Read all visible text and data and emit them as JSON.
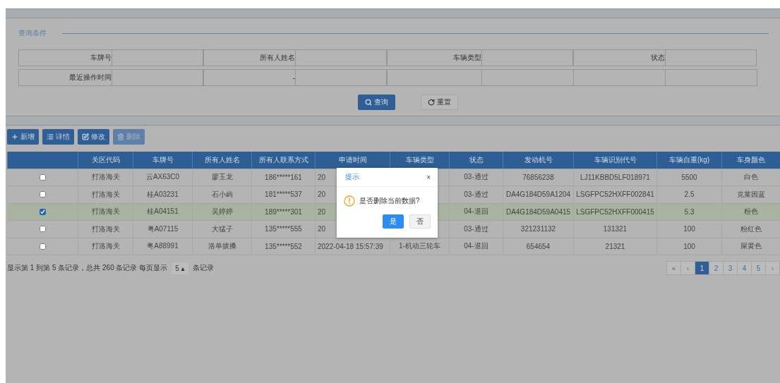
{
  "query_panel": {
    "title": "查询条件",
    "fields": [
      {
        "label": "车牌号"
      },
      {
        "label": "所有人姓名"
      },
      {
        "label": "车辆类型"
      },
      {
        "label": "状态"
      }
    ],
    "time_field": {
      "label": "最近操作时间",
      "separator": "-"
    },
    "buttons": [
      {
        "label": "查询",
        "kind": "primary"
      },
      {
        "label": "重置",
        "kind": "default"
      }
    ]
  },
  "toolbar": [
    {
      "label": "新增",
      "disabled": false
    },
    {
      "label": "详情",
      "disabled": false
    },
    {
      "label": "修改",
      "disabled": false
    },
    {
      "label": "删除",
      "disabled": true
    }
  ],
  "table": {
    "columns": [
      "关区代码",
      "车牌号",
      "所有人姓名",
      "所有人联系方式",
      "申请时间",
      "车辆类型",
      "状态",
      "发动机号",
      "车辆识别代号",
      "车辆自重(kg)",
      "车身颜色"
    ],
    "rows": [
      {
        "checked": false,
        "cells": [
          "打洛海关",
          "云AX63C0",
          "廖玉龙",
          "186*****161",
          "20",
          null,
          "03-通过",
          "76856238",
          "LJ11KBBD5LF018971",
          "5500",
          "白色"
        ]
      },
      {
        "checked": false,
        "cells": [
          "打洛海关",
          "桂A03231",
          "石小屿",
          "181*****537",
          "20",
          null,
          "03-通过",
          "DA4G184D59A1204",
          "LSGFPC52HXFF002841",
          "2.5",
          "克莱因蓝"
        ]
      },
      {
        "checked": true,
        "cells": [
          "打洛海关",
          "桂A04151",
          "吴婷婷",
          "189*****301",
          "20",
          null,
          "04-退回",
          "DA4G184D59A0415",
          "LSGFPC52HXFF000415",
          "5.3",
          "粉色"
        ]
      },
      {
        "checked": false,
        "cells": [
          "打洛海关",
          "粤A07115",
          "大猛子",
          "135*****555",
          "20",
          null,
          "03-通过",
          "321231132",
          "131321",
          "100",
          "粉红色"
        ]
      },
      {
        "checked": false,
        "cells": [
          "打洛海关",
          "粤A88991",
          "洛单拔搡",
          "135*****552",
          "2022-04-18 15:57:39",
          "1-机动三轮车",
          "04-退回",
          "654654",
          "21321",
          "100",
          "屎黄色"
        ]
      }
    ]
  },
  "footer": {
    "summary": "显示第 1 到第 5 条记录，总共 260 条记录 每页显示",
    "page_size": "5",
    "page_size_caret": "▴",
    "suffix": "条记录"
  },
  "pagination": [
    {
      "label": "«",
      "selected": false
    },
    {
      "label": "‹",
      "selected": false
    },
    {
      "label": "1",
      "selected": true
    },
    {
      "label": "2",
      "selected": false
    },
    {
      "label": "3",
      "selected": false
    },
    {
      "label": "4",
      "selected": false
    },
    {
      "label": "5",
      "selected": false
    },
    {
      "label": "›",
      "selected": false
    }
  ],
  "dialog": {
    "title": "提示",
    "close": "×",
    "message": "是否删除当前数据?",
    "buttons": [
      {
        "label": "是",
        "kind": "primary"
      },
      {
        "label": "否",
        "kind": "default"
      }
    ]
  }
}
